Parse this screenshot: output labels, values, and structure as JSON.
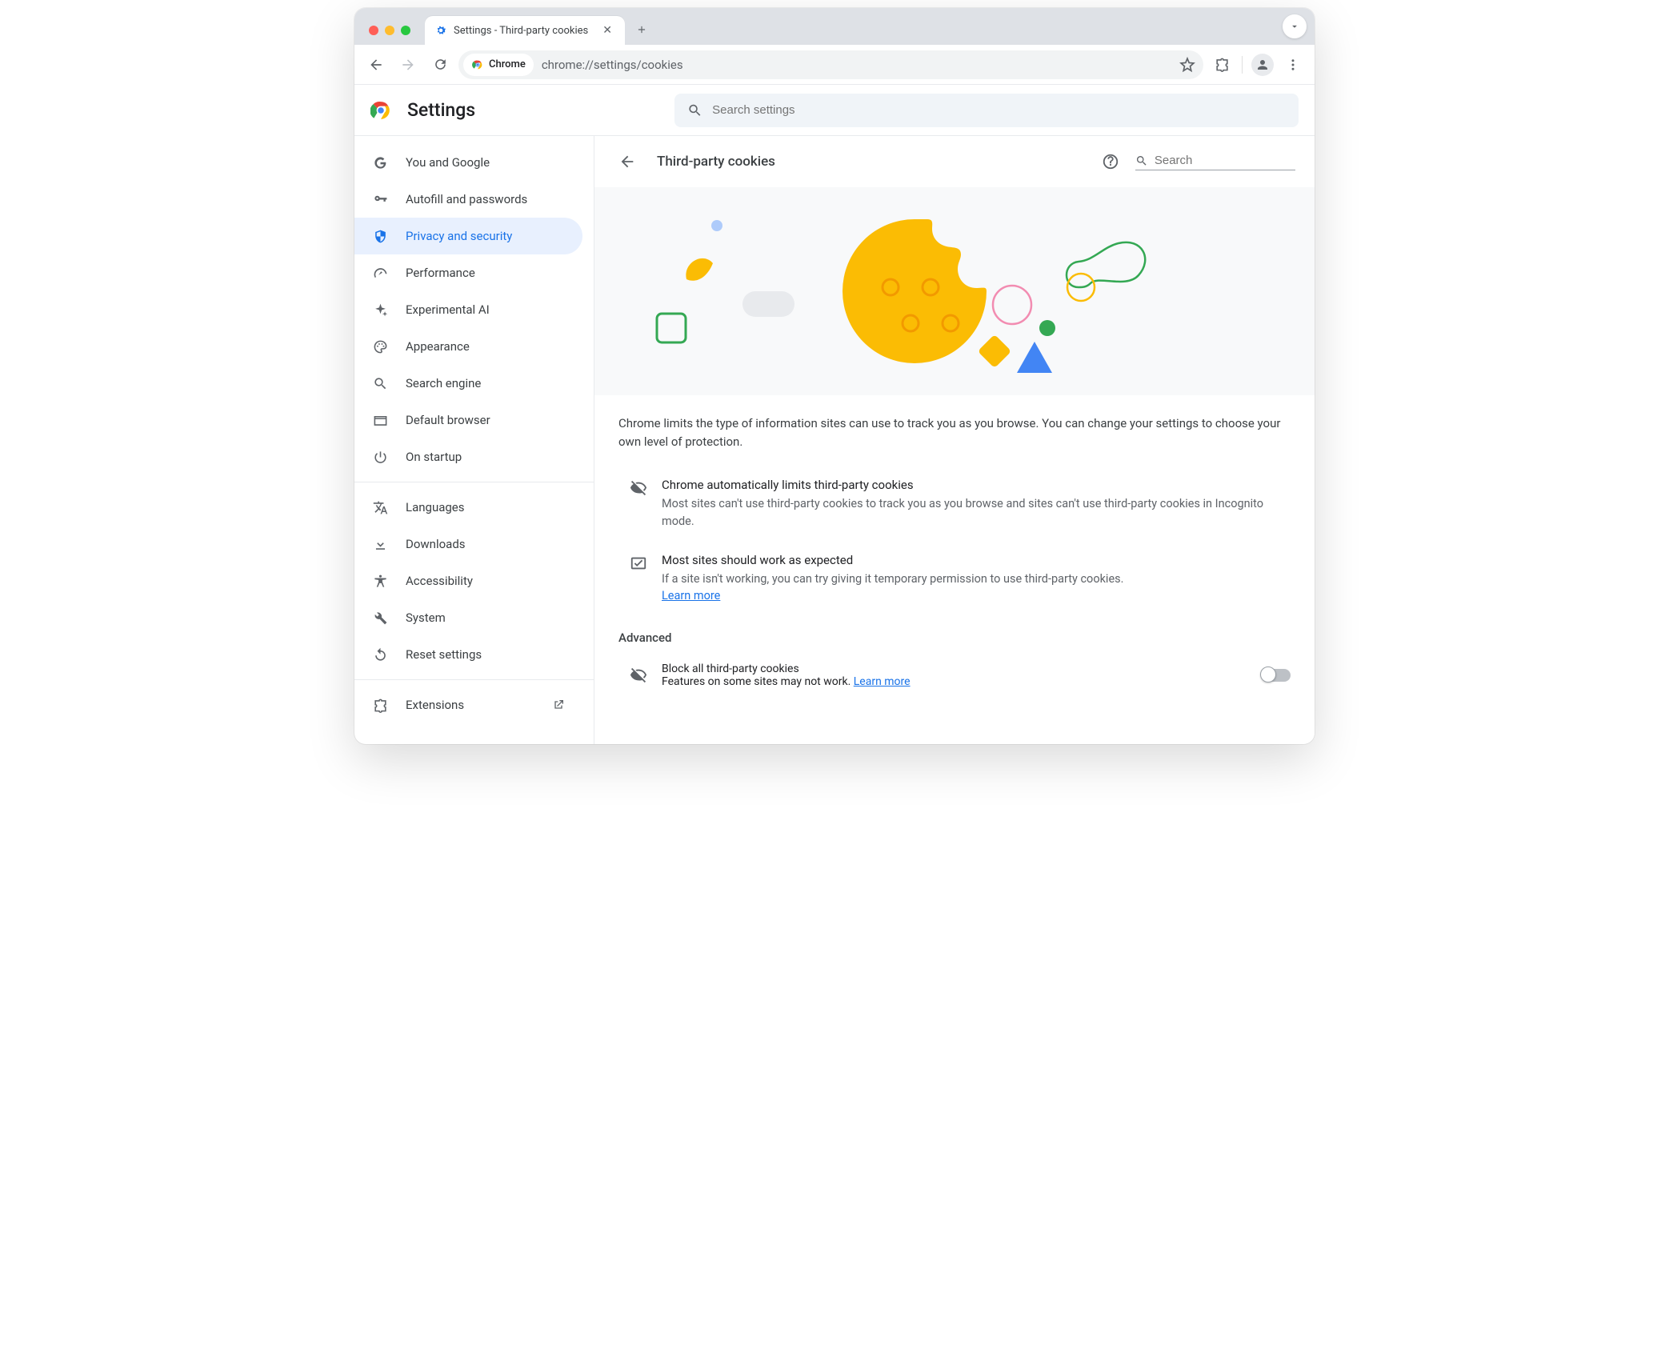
{
  "browser": {
    "tab_title": "Settings - Third-party cookies",
    "chip_label": "Chrome",
    "url": "chrome://settings/cookies"
  },
  "header": {
    "title": "Settings",
    "search_placeholder": "Search settings"
  },
  "sidebar": {
    "items": [
      {
        "label": "You and Google"
      },
      {
        "label": "Autofill and passwords"
      },
      {
        "label": "Privacy and security"
      },
      {
        "label": "Performance"
      },
      {
        "label": "Experimental AI"
      },
      {
        "label": "Appearance"
      },
      {
        "label": "Search engine"
      },
      {
        "label": "Default browser"
      },
      {
        "label": "On startup"
      }
    ],
    "items2": [
      {
        "label": "Languages"
      },
      {
        "label": "Downloads"
      },
      {
        "label": "Accessibility"
      },
      {
        "label": "System"
      },
      {
        "label": "Reset settings"
      }
    ],
    "extensions_label": "Extensions"
  },
  "page": {
    "title": "Third-party cookies",
    "search_placeholder": "Search",
    "intro": "Chrome limits the type of information sites can use to track you as you browse. You can change your settings to choose your own level of protection.",
    "row1": {
      "title": "Chrome automatically limits third-party cookies",
      "desc": "Most sites can't use third-party cookies to track you as you browse and sites can't use third-party cookies in Incognito mode."
    },
    "row2": {
      "title": "Most sites should work as expected",
      "desc": "If a site isn't working, you can try giving it temporary permission to use third-party cookies. ",
      "link": "Learn more"
    },
    "advanced_label": "Advanced",
    "block_all": {
      "title": "Block all third-party cookies",
      "desc": "Features on some sites may not work. ",
      "link": "Learn more"
    }
  }
}
